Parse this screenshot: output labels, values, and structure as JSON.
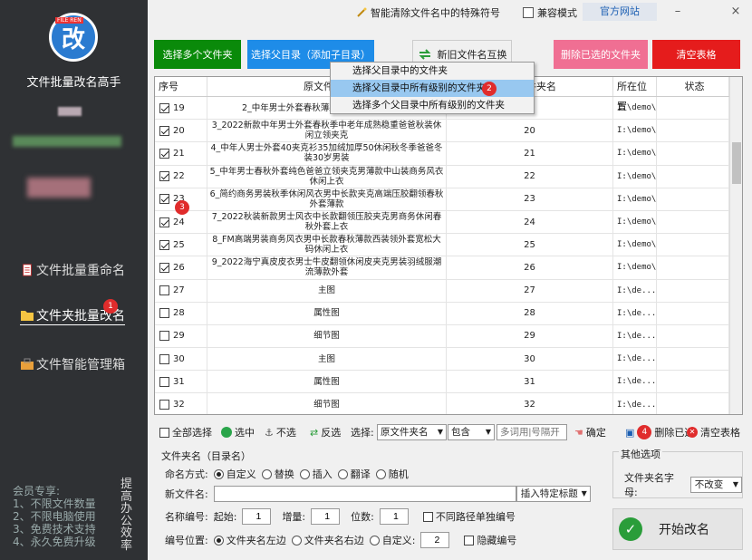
{
  "sidebar": {
    "logo_tag": "FILE REN",
    "logo_char": "改",
    "app_title": "文件批量改名高手",
    "nav": [
      {
        "label": "文件批量重命名"
      },
      {
        "label": "文件夹批量改名",
        "badge": "1"
      },
      {
        "label": "文件智能管理箱"
      }
    ],
    "member_lines": [
      "会员专享:",
      "1、不限文件数量",
      "2、不限电脑使用",
      "3、免费技术支持",
      "4、永久免费升级"
    ],
    "slogan": "提高办公效率"
  },
  "topbar": {
    "special_chars": "智能清除文件名中的特殊符号",
    "compat_mode": "兼容模式",
    "official_site": "官方网站",
    "minimize": "–",
    "close": "×"
  },
  "actions": {
    "select_multiple": "选择多个文件夹",
    "select_parent": "选择父目录（添加子目录）",
    "swap_names": "新旧文件名互换",
    "delete_selected": "删除已选的文件夹",
    "clear_table": "清空表格"
  },
  "dropdown": {
    "items": [
      "选择父目录中的文件夹",
      "选择父目录中所有级别的文件夹",
      "选择多个父目录中所有级别的文件夹"
    ],
    "selected_badge": "2"
  },
  "table": {
    "headers": [
      "序号",
      "原文件夹名",
      "新文件夹名",
      "所在位置",
      "状态"
    ],
    "badge": "3",
    "rows": [
      {
        "n": "19",
        "checked": true,
        "orig": "2_中年男士外套春秋薄款2022新款休闲夹克",
        "new": "",
        "loc": "I:\\demo\\"
      },
      {
        "n": "20",
        "checked": true,
        "orig": "3_2022新款中年男士外套春秋季中老年成熟稳重爸爸秋装休闲立领夹克",
        "new": "20",
        "loc": "I:\\demo\\"
      },
      {
        "n": "21",
        "checked": true,
        "orig": "4_中年人男士外套40夹克衫35加绒加厚50休闲秋冬季爸爸冬装30岁男装",
        "new": "21",
        "loc": "I:\\demo\\"
      },
      {
        "n": "22",
        "checked": true,
        "orig": "5_中年男士春秋外套纯色爸爸立领夹克男薄款中山装商务风衣休闲上衣",
        "new": "22",
        "loc": "I:\\demo\\"
      },
      {
        "n": "23",
        "checked": true,
        "orig": "6_简约商务男装秋季休闲风衣男中长款夹克高端压胶翻领春秋外套薄款",
        "new": "23",
        "loc": "I:\\demo\\"
      },
      {
        "n": "24",
        "checked": true,
        "orig": "7_2022秋装新款男士风衣中长款翻领压胶夹克男商务休闲春秋外套上衣",
        "new": "24",
        "loc": "I:\\demo\\"
      },
      {
        "n": "25",
        "checked": true,
        "orig": "8_FM高端男装商务风衣男中长款春秋薄款西装领外套宽松大码休闲上衣",
        "new": "25",
        "loc": "I:\\demo\\"
      },
      {
        "n": "26",
        "checked": true,
        "orig": "9_2022海宁真皮皮衣男士牛皮翻领休闲皮夹克男装羽绒服潮流薄款外套",
        "new": "26",
        "loc": "I:\\demo\\"
      },
      {
        "n": "27",
        "checked": false,
        "orig": "主图",
        "new": "27",
        "loc": "I:\\de..."
      },
      {
        "n": "28",
        "checked": false,
        "orig": "属性图",
        "new": "28",
        "loc": "I:\\de..."
      },
      {
        "n": "29",
        "checked": false,
        "orig": "细节图",
        "new": "29",
        "loc": "I:\\de..."
      },
      {
        "n": "30",
        "checked": false,
        "orig": "主图",
        "new": "30",
        "loc": "I:\\de..."
      },
      {
        "n": "31",
        "checked": false,
        "orig": "属性图",
        "new": "31",
        "loc": "I:\\de..."
      },
      {
        "n": "32",
        "checked": false,
        "orig": "细节图",
        "new": "32",
        "loc": "I:\\de..."
      }
    ]
  },
  "select_tools": {
    "select_all": "全部选择",
    "check": "选中",
    "uncheck": "不选",
    "invert": "反选",
    "select_label": "选择:",
    "field": "原文件夹名",
    "mode": "包含",
    "keyword_placeholder": "多词用|号隔开",
    "confirm": "确定",
    "delete_checked": "删除已选",
    "delete_badge": "4",
    "clear": "清空表格"
  },
  "folder_options": {
    "group": "文件夹名（目录名）",
    "naming_label": "命名方式:",
    "modes": [
      "自定义",
      "替换",
      "插入",
      "翻译",
      "随机"
    ],
    "new_name_label": "新文件名:",
    "new_name_value": "",
    "insert_tag": "插入特定标题",
    "numbering_label": "名称编号:",
    "start_label": "起始:",
    "start_value": "1",
    "step_label": "增量:",
    "step_value": "1",
    "digits_label": "位数:",
    "digits_value": "1",
    "separate_path": "不同路径单独编号",
    "position_label": "编号位置:",
    "positions": [
      "文件夹名左边",
      "文件夹名右边",
      "自定义:"
    ],
    "custom_value": "2",
    "hide_number": "隐藏编号"
  },
  "other_options": {
    "group": "其他选项",
    "case_label": "文件夹名字母:",
    "case_value": "不改变"
  },
  "start_button": "开始改名",
  "colors": {
    "sidebar": "#2f3134",
    "green": "#0a8a0a",
    "blue": "#1e8ce8",
    "pink": "#f06f93",
    "red": "#e51c1c"
  }
}
